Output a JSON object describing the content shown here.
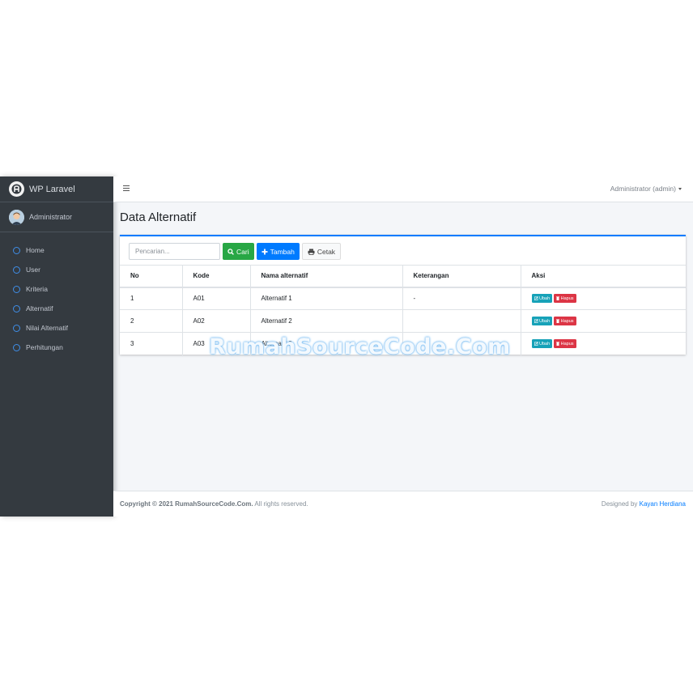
{
  "sidebar": {
    "brand": "WP Laravel",
    "user": "Administrator",
    "items": [
      {
        "label": "Home"
      },
      {
        "label": "User"
      },
      {
        "label": "Kriteria"
      },
      {
        "label": "Alternatif"
      },
      {
        "label": "Nilai Alternatif"
      },
      {
        "label": "Perhitungan"
      }
    ]
  },
  "navbar": {
    "user_menu": "Administrator (admin)"
  },
  "page": {
    "title": "Data Alternatif"
  },
  "toolbar": {
    "search_placeholder": "Pencarian...",
    "search_label": "Cari",
    "add_label": "Tambah",
    "print_label": "Cetak"
  },
  "table": {
    "headers": [
      "No",
      "Kode",
      "Nama alternatif",
      "Keterangan",
      "Aksi"
    ],
    "rows": [
      {
        "no": "1",
        "kode": "A01",
        "nama": "Alternatif 1",
        "ket": "-",
        "edit": "Ubah",
        "delete": "Hapus"
      },
      {
        "no": "2",
        "kode": "A02",
        "nama": "Alternatif 2",
        "ket": "",
        "edit": "Ubah",
        "delete": "Hapus"
      },
      {
        "no": "3",
        "kode": "A03",
        "nama": "Alternatif 3",
        "ket": "",
        "edit": "Ubah",
        "delete": "Hapus"
      }
    ]
  },
  "watermark": "RumahSourceCode.Com",
  "footer": {
    "copyright_prefix": "Copyright © 2021 RumahSourceCode.Com.",
    "copyright_suffix": " All rights reserved.",
    "designed_by": "Designed by ",
    "author": "Kayan Herdiana"
  },
  "colors": {
    "sidebar_bg": "#343a40",
    "primary": "#007bff",
    "success": "#28a745",
    "info": "#17a2b8",
    "danger": "#dc3545"
  }
}
